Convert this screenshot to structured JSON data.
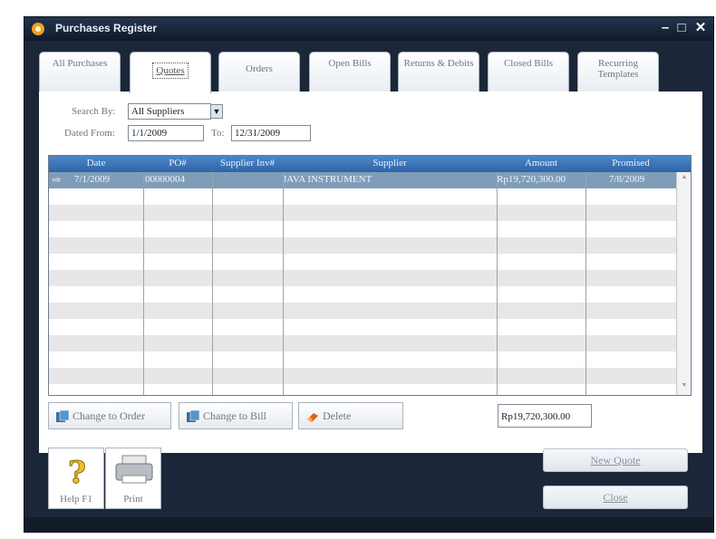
{
  "window": {
    "title": "Purchases Register"
  },
  "tabs": [
    {
      "label": "All Purchases"
    },
    {
      "label": "Quotes"
    },
    {
      "label": "Orders"
    },
    {
      "label": "Open Bills"
    },
    {
      "label": "Returns & Debits"
    },
    {
      "label": "Closed Bills"
    },
    {
      "label": "Recurring Templates"
    }
  ],
  "filters": {
    "search_by_label": "Search By:",
    "search_by_value": "All Suppliers",
    "dated_from_label": "Dated From:",
    "dated_from_value": "1/1/2009",
    "to_label": "To:",
    "to_value": "12/31/2009"
  },
  "grid": {
    "columns": [
      "Date",
      "PO#",
      "Supplier Inv#",
      "Supplier",
      "Amount",
      "Promised"
    ],
    "rows": [
      {
        "date": "7/1/2009",
        "po": "00000004",
        "supplier_inv": "",
        "supplier": "JAVA INSTRUMENT",
        "amount": "Rp19,720,300.00",
        "promised": "7/8/2009"
      }
    ]
  },
  "actions": {
    "change_to_order": "Change to Order",
    "change_to_bill": "Change to Bill",
    "delete": "Delete",
    "total": "Rp19,720,300.00"
  },
  "bottom": {
    "help": "Help F1",
    "print": "Print",
    "new_quote": "New Quote",
    "close": "Close"
  },
  "colors": {
    "window_bg": "#1b2738",
    "grid_header": "#3a72b4",
    "selected_row": "#7f9db9"
  }
}
